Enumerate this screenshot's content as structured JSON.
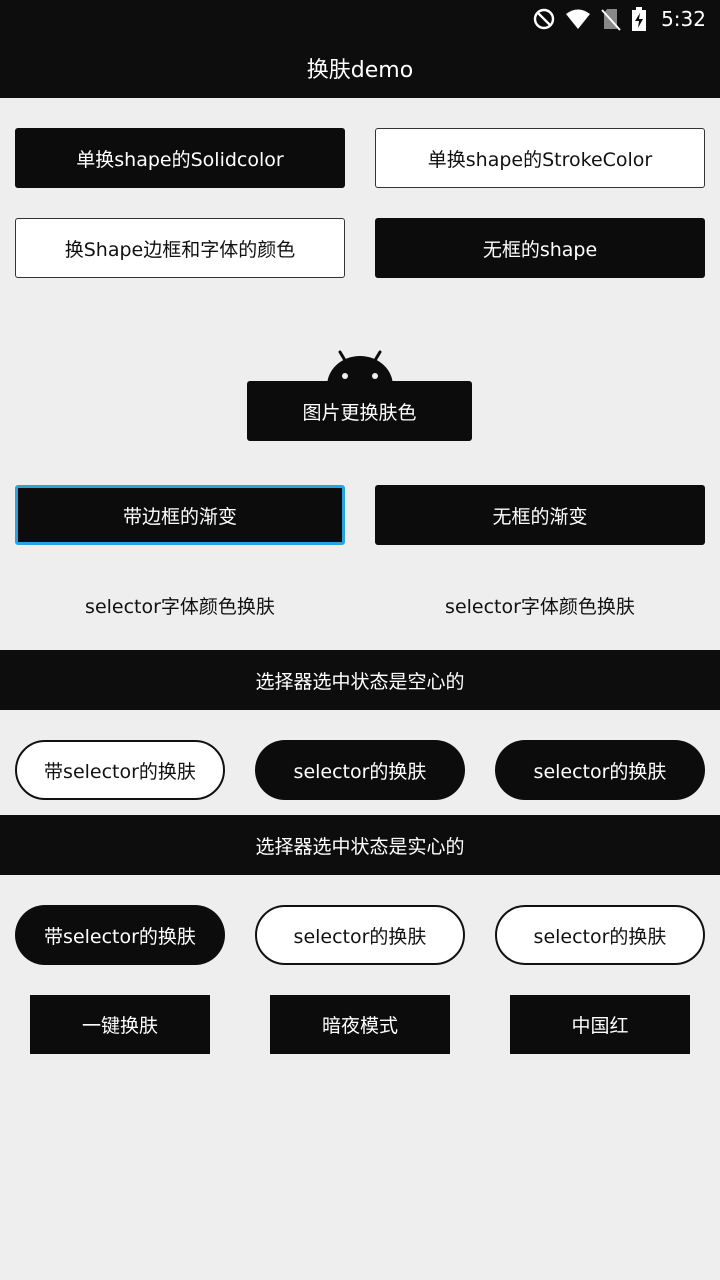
{
  "status_bar": {
    "time": "5:32",
    "icons": [
      "do-not-disturb-icon",
      "wifi-icon",
      "no-sim-icon",
      "battery-charging-icon"
    ]
  },
  "app_bar": {
    "title": "换肤demo"
  },
  "buttons": {
    "solid_color": "单换shape的Solidcolor",
    "stroke_color": "单换shape的StrokeColor",
    "shape_border_font": "换Shape边框和字体的颜色",
    "no_border_shape": "无框的shape",
    "image_skin": "图片更换肤色",
    "gradient_border": "带边框的渐变",
    "gradient_no_border": "无框的渐变"
  },
  "selector_text": {
    "left": "selector字体颜色换肤",
    "right": "selector字体颜色换肤"
  },
  "section_hollow": {
    "title": "选择器选中状态是空心的",
    "items": [
      "带selector的换肤",
      "selector的换肤",
      "selector的换肤"
    ]
  },
  "section_solid": {
    "title": "选择器选中状态是实心的",
    "items": [
      "带selector的换肤",
      "selector的换肤",
      "selector的换肤"
    ]
  },
  "skin_actions": {
    "one_key": "一键换肤",
    "night_mode": "暗夜模式",
    "china_red": "中国红"
  },
  "colors": {
    "dark": "#0c0c0c",
    "background": "#eeeeee",
    "focus_border": "#29a3e0"
  }
}
